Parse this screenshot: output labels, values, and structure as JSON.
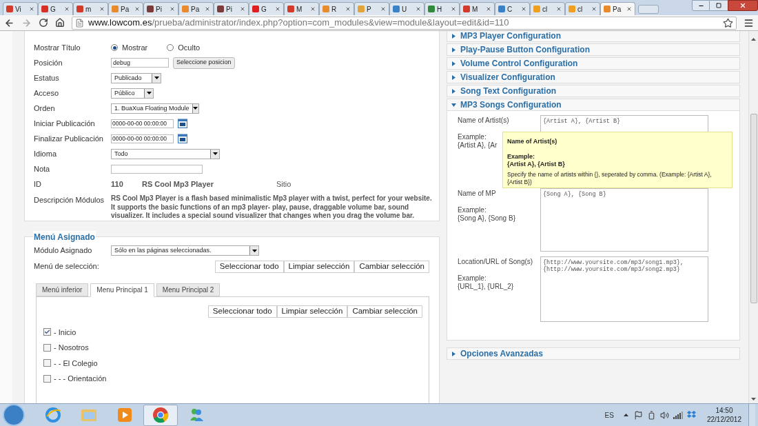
{
  "browser": {
    "tabs": [
      {
        "label": "Vi",
        "color": "#d23a2a",
        "selected": false
      },
      {
        "label": "G",
        "color": "#d93025",
        "selected": false
      },
      {
        "label": "m",
        "color": "#d23a2a",
        "selected": false
      },
      {
        "label": "Pa",
        "color": "#e98a2c",
        "selected": false
      },
      {
        "label": "Pi",
        "color": "#7a3b3b",
        "selected": false
      },
      {
        "label": "Pa",
        "color": "#e98a2c",
        "selected": false
      },
      {
        "label": "Pi",
        "color": "#7a3b3b",
        "selected": false
      },
      {
        "label": "G",
        "color": "#e02020",
        "selected": false
      },
      {
        "label": "M",
        "color": "#d23a2a",
        "selected": false
      },
      {
        "label": "R",
        "color": "#e98a2c",
        "selected": false
      },
      {
        "label": "P",
        "color": "#e3a53a",
        "selected": false
      },
      {
        "label": "U",
        "color": "#3a82c8",
        "selected": false
      },
      {
        "label": "H",
        "color": "#2f8a3c",
        "selected": false
      },
      {
        "label": "M",
        "color": "#d23a2a",
        "selected": false
      },
      {
        "label": "C",
        "color": "#3a82c8",
        "selected": false
      },
      {
        "label": "cl",
        "color": "#f0a020",
        "selected": false
      },
      {
        "label": "cl",
        "color": "#f0a020",
        "selected": false
      },
      {
        "label": "Pa",
        "color": "#e98a2c",
        "selected": true
      }
    ],
    "url": {
      "domain": "www.lowcom.es",
      "path": "/prueba/administrator/index.php?option=com_modules&view=module&layout=edit&id=110"
    }
  },
  "details": {
    "fields": [
      {
        "kind": "radio",
        "label": "Mostrar Título",
        "options": [
          {
            "label": "Mostrar",
            "selected": true
          },
          {
            "label": "Oculto",
            "selected": false
          }
        ]
      },
      {
        "kind": "text_button",
        "label": "Posición",
        "value": "debug",
        "button": "Seleccione posicion"
      },
      {
        "kind": "select",
        "label": "Estatus",
        "value": "Publicado"
      },
      {
        "kind": "select",
        "label": "Acceso",
        "value": "Público"
      },
      {
        "kind": "select",
        "label": "Orden",
        "value": "1. BuaXua Floating Module"
      },
      {
        "kind": "date",
        "label": "Iniciar Publicación",
        "value": "0000-00-00 00:00:00"
      },
      {
        "kind": "date",
        "label": "Finalizar Publicación",
        "value": "0000-00-00 00:00:00"
      },
      {
        "kind": "select",
        "label": "Idioma",
        "value": "Todo"
      },
      {
        "kind": "text",
        "label": "Nota"
      },
      {
        "kind": "info",
        "label": "ID",
        "values": [
          "110",
          "RS Cool Mp3 Player",
          "Sitio"
        ]
      },
      {
        "kind": "description",
        "label": "Descripción Módulos",
        "value": "RS Cool Mp3 Player is a flash based minimalistic Mp3 player with a twist, perfect for your website. It supports the basic functions of an mp3 player- play, pause, draggable volume bar, sound visualizer. It includes a special sound visualizer that changes when you drag the volume bar."
      }
    ]
  },
  "menu_assignment": {
    "title": "Menú Asignado",
    "module_label": "Módulo Asignado",
    "module_value": "Sólo en las páginas seleccionadas.",
    "selection_label": "Menú de selección:",
    "buttons": [
      "Seleccionar todo",
      "Limpiar selección",
      "Cambiar selección"
    ],
    "tabs": [
      {
        "label": "Menú inferior",
        "selected": false
      },
      {
        "label": "Menu Principal 1",
        "selected": true
      },
      {
        "label": "Menu Principal 2",
        "selected": false
      }
    ],
    "tab_buttons": [
      "Seleccionar todo",
      "Limpiar selección",
      "Cambiar selección"
    ],
    "items": [
      {
        "label": "- Inicio",
        "checked": true
      },
      {
        "label": "- Nosotros",
        "checked": false
      },
      {
        "label": "- - El Colegio",
        "checked": false
      },
      {
        "label": "- - - Orientación",
        "checked": false
      }
    ]
  },
  "accordion": [
    {
      "title": "MP3 Player Configuration",
      "expanded": false
    },
    {
      "title": "Play-Pause Button Configuration",
      "expanded": false
    },
    {
      "title": "Volume Control Configuration",
      "expanded": false
    },
    {
      "title": "Visualizer Configuration",
      "expanded": false
    },
    {
      "title": "Song Text Configuration",
      "expanded": false
    },
    {
      "title": "MP3 Songs Configuration",
      "expanded": true,
      "fields": [
        {
          "label": "Name of Artist(s)",
          "example_label": "Example:",
          "example": "{Artist A}, {Ar",
          "value": "{Artist A}, {Artist B}"
        },
        {
          "label": "Name of MP",
          "example_label": "Example:",
          "example": "{Song A}, {Song B}",
          "value": "{Song A}, {Song B}"
        },
        {
          "label": "Location/URL of Song(s)",
          "example_label": "Example:",
          "example": "{URL_1}, {URL_2}",
          "value": "{http://www.yoursite.com/mp3/song1.mp3},\n{http://www.yoursite.com/mp3/song2.mp3}"
        }
      ]
    },
    {
      "title": "Opciones Avanzadas",
      "expanded": false
    }
  ],
  "tooltip": {
    "title": "Name of Artist(s)",
    "example_label": "Example:",
    "example": "{Artist A}, {Artist B}",
    "text": "Specify the name of artists within {}, seperated by comma. (Example: {Artist A}, {Artist B})"
  },
  "taskbar": {
    "language": "ES",
    "time": "14:50",
    "date": "22/12/2012",
    "apps": [
      {
        "kind": "ie",
        "selected": false
      },
      {
        "kind": "folder",
        "selected": false
      },
      {
        "kind": "media",
        "selected": false
      },
      {
        "kind": "chrome",
        "selected": true
      },
      {
        "kind": "messenger",
        "selected": false
      }
    ]
  }
}
